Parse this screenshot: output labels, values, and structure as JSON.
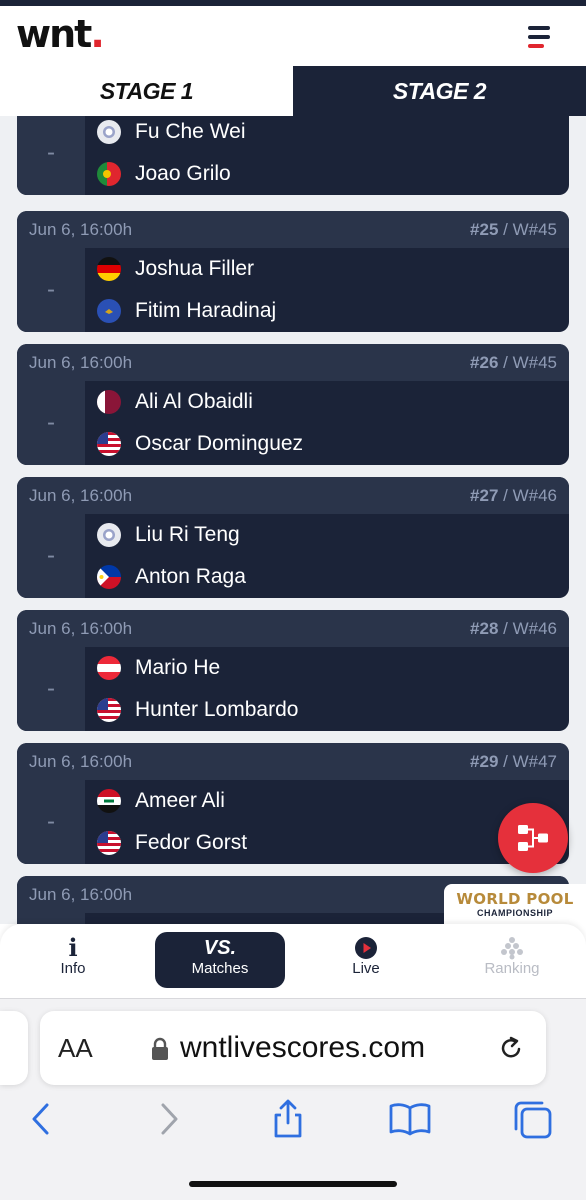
{
  "header": {
    "logo_text": "wnt",
    "logo_dot": "."
  },
  "stages": [
    "STAGE 1",
    "STAGE 2"
  ],
  "matches": [
    {
      "date": "",
      "number": "",
      "winner_slot": "",
      "score": "-",
      "p1": "Fu Che Wei",
      "p1_flag": "chinese-taipei",
      "p2": "Joao Grilo",
      "p2_flag": "portugal"
    },
    {
      "date": "Jun 6, 16:00h",
      "number": "#25",
      "winner_slot": "/ W#45",
      "score": "-",
      "p1": "Joshua Filler",
      "p1_flag": "germany",
      "p2": "Fitim Haradinaj",
      "p2_flag": "kosovo"
    },
    {
      "date": "Jun 6, 16:00h",
      "number": "#26",
      "winner_slot": "/ W#45",
      "score": "-",
      "p1": "Ali Al Obaidli",
      "p1_flag": "qatar",
      "p2": "Oscar Dominguez",
      "p2_flag": "usa"
    },
    {
      "date": "Jun 6, 16:00h",
      "number": "#27",
      "winner_slot": "/ W#46",
      "score": "-",
      "p1": "Liu Ri Teng",
      "p1_flag": "chinese-taipei",
      "p2": "Anton Raga",
      "p2_flag": "philippines"
    },
    {
      "date": "Jun 6, 16:00h",
      "number": "#28",
      "winner_slot": "/ W#46",
      "score": "-",
      "p1": "Mario He",
      "p1_flag": "austria",
      "p2": "Hunter Lombardo",
      "p2_flag": "usa"
    },
    {
      "date": "Jun 6, 16:00h",
      "number": "#29",
      "winner_slot": "/ W#47",
      "score": "-",
      "p1": "Ameer Ali",
      "p1_flag": "iraq",
      "p2": "Fedor Gorst",
      "p2_flag": "usa"
    },
    {
      "date": "Jun 6, 16:00h",
      "number": "",
      "winner_slot": "",
      "score": "",
      "p1": "",
      "p1_flag": "",
      "p2": "",
      "p2_flag": ""
    }
  ],
  "branding": {
    "line1": "WORLD POOL",
    "line2": "CHAMPIONSHIP"
  },
  "tabs": [
    {
      "label": "Info",
      "icon": "info-icon"
    },
    {
      "label": "Matches",
      "icon": "vs-icon",
      "icon_text": "VS."
    },
    {
      "label": "Live",
      "icon": "play-icon"
    },
    {
      "label": "Ranking",
      "icon": "ranking-icon"
    }
  ],
  "browser": {
    "aa": "AA",
    "url": "wntlivescores.com"
  },
  "colors": {
    "navy": "#1b2338",
    "accent_red": "#e0262e",
    "card_header": "#2a344a",
    "brand_gold": "#b78a3a"
  }
}
